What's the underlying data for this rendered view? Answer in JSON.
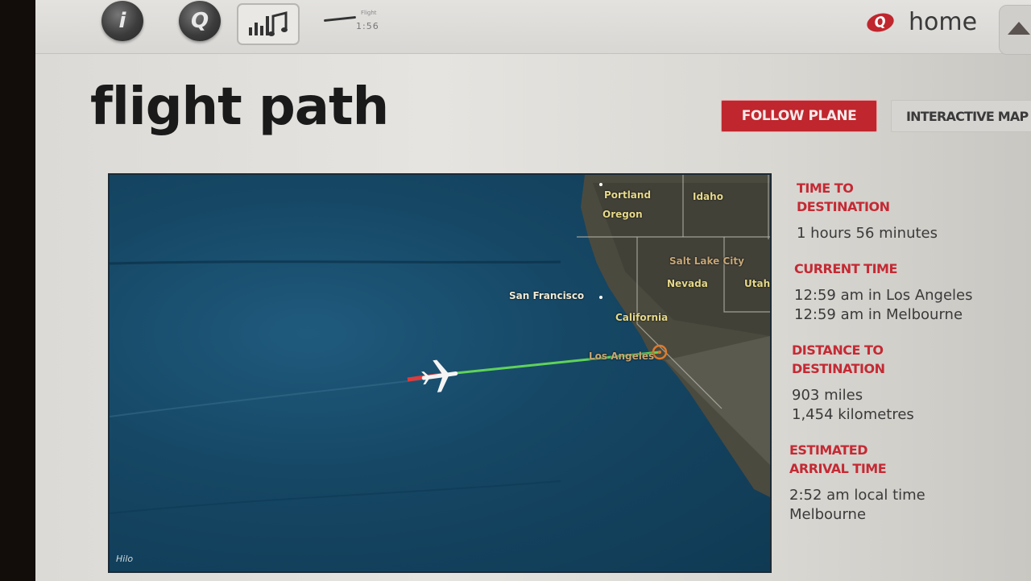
{
  "topbar": {
    "info_icon_glyph": "i",
    "q_icon_glyph": "Q",
    "mini_flight_label": "Flight",
    "mini_flight_time": "1:56",
    "home_logo_glyph": "Q",
    "home_label": "home"
  },
  "page": {
    "title": "flight path"
  },
  "tabs": {
    "follow_plane": "FOLLOW PLANE",
    "interactive_map": "INTERACTIVE MAP"
  },
  "map": {
    "labels": {
      "portland": "Portland",
      "oregon": "Oregon",
      "idaho": "Idaho",
      "salt_lake_city": "Salt Lake City",
      "nevada": "Nevada",
      "utah": "Utah",
      "san_francisco": "San Francisco",
      "california": "California",
      "los_angeles": "Los Angeles"
    },
    "provider_logo": "Hilo",
    "colors": {
      "route_flown": "#e03a3a",
      "route_remaining": "#5fd35a",
      "destination_marker": "#e07a2a",
      "label": "#e6d98a"
    }
  },
  "info": {
    "time_to_destination": {
      "heading": "TIME TO DESTINATION",
      "value": "1 hours 56 minutes"
    },
    "current_time": {
      "heading": "CURRENT TIME",
      "origin": "12:59 am in Los Angeles",
      "destination": "12:59 am in Melbourne"
    },
    "distance_to_destination": {
      "heading": "DISTANCE TO DESTINATION",
      "miles": "903 miles",
      "kilometres": "1,454 kilometres"
    },
    "estimated_arrival": {
      "heading": "ESTIMATED ARRIVAL TIME",
      "time": "2:52 am local time",
      "place": "Melbourne"
    }
  },
  "theme": {
    "accent": "#c0262d",
    "text_dark": "#1a1a1a"
  }
}
